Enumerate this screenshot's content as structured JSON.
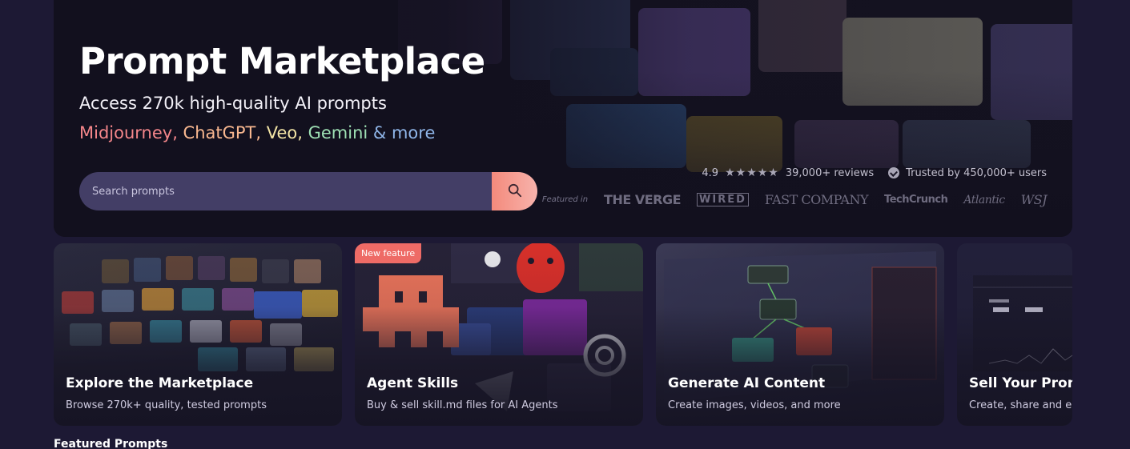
{
  "hero": {
    "title": "Prompt Marketplace",
    "subtitle": "Access 270k high-quality AI prompts",
    "models": [
      {
        "text": "Midjourney,",
        "color": "#f4868a"
      },
      {
        "text": " ChatGPT,",
        "color": "#f9b890"
      },
      {
        "text": " Veo,",
        "color": "#f1e3a4"
      },
      {
        "text": " Gemini",
        "color": "#9ee0b4"
      },
      {
        "text": " & more",
        "color": "#8fb5e8"
      }
    ]
  },
  "search": {
    "placeholder": "Search prompts",
    "button_icon": "search-icon"
  },
  "stats": {
    "rating": "4.9",
    "stars": "★★★★★",
    "reviews": "39,000+ reviews",
    "trusted": "Trusted by 450,000+ users"
  },
  "press": {
    "featured_label": "Featured in",
    "logos": [
      "THE VERGE",
      "WIRED",
      "FAST COMPANY",
      "TechCrunch",
      "Atlantic",
      "WSJ"
    ]
  },
  "cards": [
    {
      "title": "Explore the Marketplace",
      "desc": "Browse 270k+ quality, tested prompts"
    },
    {
      "title": "Agent Skills",
      "desc": "Buy & sell skill.md files for AI Agents",
      "badge": "New feature"
    },
    {
      "title": "Generate AI Content",
      "desc": "Create images, videos, and more"
    },
    {
      "title": "Sell Your Prompts",
      "desc": "Create, share and earn"
    }
  ],
  "sections": {
    "featured_heading": "Featured Prompts"
  },
  "colors": {
    "page_bg": "#1d1934",
    "search_bg": "#433e66",
    "search_button_gradient": [
      "#f48a7c",
      "#f7b3ac"
    ],
    "badge_bg": "#ee6b66"
  }
}
